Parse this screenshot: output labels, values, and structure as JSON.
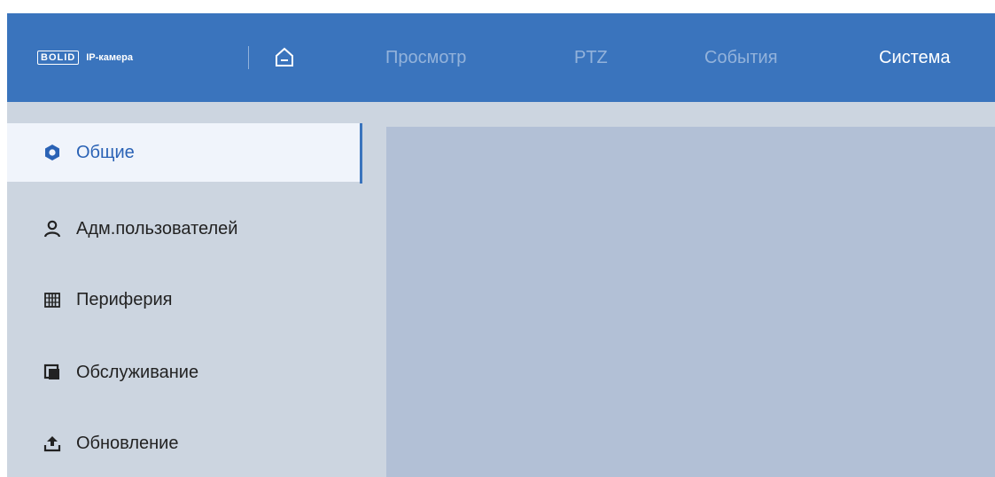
{
  "header": {
    "logo_mark": "BOLID",
    "brand": "IP-камера",
    "nav": [
      {
        "label": "Просмотр",
        "active": false
      },
      {
        "label": "PTZ",
        "active": false
      },
      {
        "label": "События",
        "active": false
      },
      {
        "label": "Система",
        "active": true
      }
    ]
  },
  "sidebar": {
    "items": [
      {
        "label": "Общие",
        "icon": "gear-icon",
        "selected": true
      },
      {
        "label": "Адм.пользователей",
        "icon": "user-icon",
        "selected": false
      },
      {
        "label": "Периферия",
        "icon": "peripheral-icon",
        "selected": false
      },
      {
        "label": "Обслуживание",
        "icon": "maintenance-icon",
        "selected": false
      },
      {
        "label": "Обновление",
        "icon": "upload-icon",
        "selected": false
      }
    ]
  },
  "colors": {
    "header_bg": "#3a74bd",
    "sidebar_bg": "#ccd5e0",
    "selected_item_bg": "#f0f4fb",
    "content_bg": "#b2c0d6",
    "accent": "#2a62b5"
  }
}
